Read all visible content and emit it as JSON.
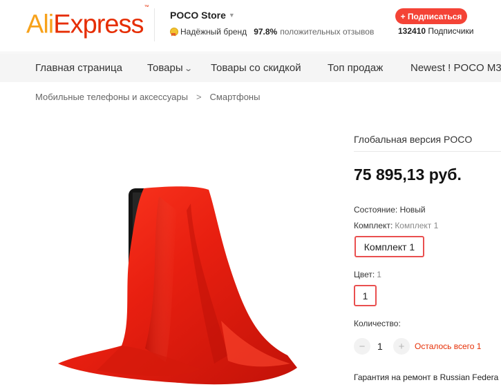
{
  "header": {
    "logo": {
      "part1": "Ali",
      "part2": "Express",
      "tm": "™"
    },
    "store_name": "POCO Store",
    "badge": "Надёжный бренд",
    "positive_pct": "97.8%",
    "positive_label": "положительных отзывов",
    "subscribe_label": "+ Подписаться",
    "subscribers_count": "132410",
    "subscribers_label": "Подписчики"
  },
  "nav": {
    "items": [
      "Главная страница",
      "Товары",
      "Товары со скидкой",
      "Топ продаж",
      "Newest ! POCO M3"
    ]
  },
  "breadcrumb": [
    "Мобильные телефоны и аксессуары",
    "Смартфоны"
  ],
  "product": {
    "subtitle": "Глобальная версия POCO",
    "price": "75 895,13 руб.",
    "condition_label": "Состояние:",
    "condition_value": "Новый",
    "kit_label": "Комплект:",
    "kit_value": "Комплект 1",
    "kit_option": "Комплект 1",
    "color_label": "Цвет:",
    "color_value": "1",
    "color_option": "1",
    "quantity_label": "Количество:",
    "quantity": "1",
    "minus": "−",
    "plus": "+",
    "stock_note": "Осталось всего 1",
    "warranty": "Гарантия на ремонт в Russian Federa"
  },
  "colors": {
    "brand_orange": "#f7a21b",
    "brand_red": "#e62e04",
    "button_red": "#f44336",
    "selected_border": "#e94f4f"
  }
}
